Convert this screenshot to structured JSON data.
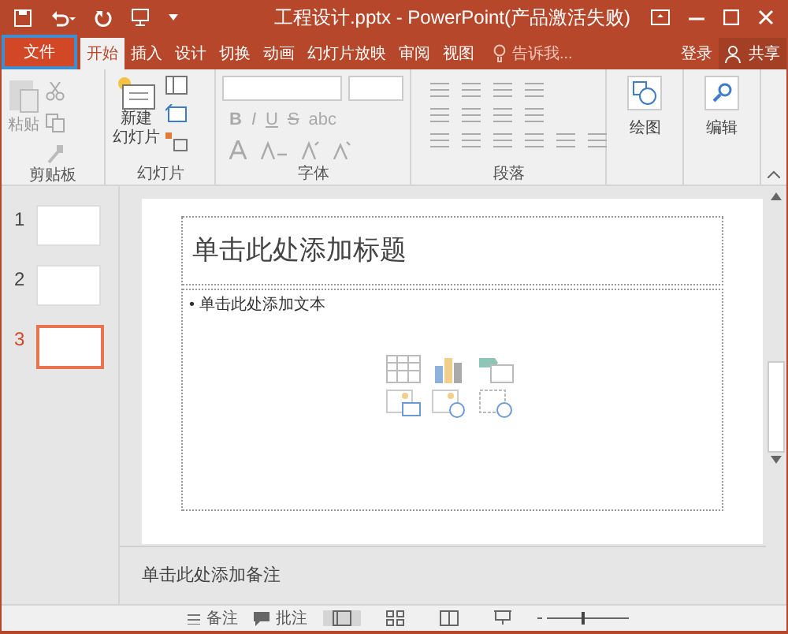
{
  "window": {
    "title": "工程设计.pptx - PowerPoint(产品激活失败)"
  },
  "tabs": [
    {
      "label": "文件",
      "kind": "file",
      "selected": false
    },
    {
      "label": "开始",
      "kind": "tab",
      "selected": true
    },
    {
      "label": "插入",
      "kind": "tab",
      "selected": false
    },
    {
      "label": "设计",
      "kind": "tab",
      "selected": false
    },
    {
      "label": "切换",
      "kind": "tab",
      "selected": false
    },
    {
      "label": "动画",
      "kind": "tab",
      "selected": false
    },
    {
      "label": "幻灯片放映",
      "kind": "tab",
      "selected": false
    },
    {
      "label": "审阅",
      "kind": "tab",
      "selected": false
    },
    {
      "label": "视图",
      "kind": "tab",
      "selected": false
    }
  ],
  "tell_me": "告诉我...",
  "sign_in": "登录",
  "share": "共享",
  "ribbon": {
    "paste": "粘贴",
    "new_slide": [
      "新建",
      "幻灯片"
    ],
    "font_buttons": [
      "B",
      "I",
      "U",
      "S",
      "abc"
    ],
    "drawing": "绘图",
    "editing": "编辑",
    "groups": [
      "剪贴板",
      "幻灯片",
      "字体",
      "段落"
    ]
  },
  "slides": [
    {
      "number": "1",
      "selected": false
    },
    {
      "number": "2",
      "selected": false
    },
    {
      "number": "3",
      "selected": true
    }
  ],
  "slide": {
    "title_placeholder": "单击此处添加标题",
    "body_placeholder": "• 单击此处添加文本"
  },
  "notes": "单击此处添加备注",
  "status_bar": {
    "notes": "备注",
    "comments": "批注"
  }
}
